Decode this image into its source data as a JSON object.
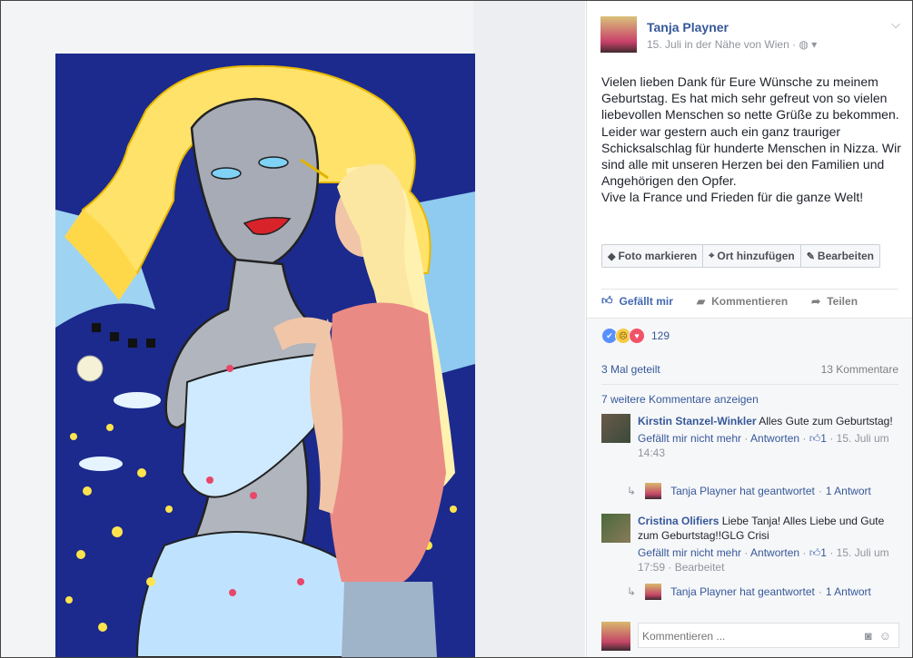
{
  "post": {
    "author": "Tanja Playner",
    "date": "15. Juli in der Nähe von Wien",
    "meta_sep": " · ",
    "privacy_icon": "globe-icon",
    "text": [
      "Vielen lieben Dank für Eure Wünsche zu meinem Geburtstag. Es hat mich sehr gefreut von so vielen liebevollen Menschen so nette Grüße zu bekommen.",
      "Leider war gestern auch ein ganz trauriger Schicksalschlag für hunderte Menschen in Nizza. Wir sind alle mit unseren Herzen bei den Familien und Angehörigen den Opfer.",
      "Vive la France und Frieden für die ganze Welt!"
    ]
  },
  "photo_actions": {
    "tag": "Foto markieren",
    "location": "Ort hinzufügen",
    "edit": "Bearbeiten"
  },
  "action_bar": {
    "like": "Gefällt mir",
    "comment": "Kommentieren",
    "share": "Teilen"
  },
  "reactions": {
    "count": "129",
    "types": [
      "like",
      "sad",
      "love"
    ]
  },
  "stats": {
    "shares": "3 Mal geteilt",
    "comments": "13 Kommentare"
  },
  "more_comments": "7 weitere Kommentare anzeigen",
  "comments": [
    {
      "author": "Kirstin Stanzel-Winkler",
      "text": "Alles Gute zum Geburtstag!",
      "unlike": "Gefällt mir nicht mehr",
      "reply": "Antworten",
      "likes": "1",
      "time": "15. Juli um 14:43",
      "edited": "",
      "reply_summary": {
        "text": "Tanja Playner hat geantwortet",
        "count": "1 Antwort"
      }
    },
    {
      "author": "Cristina Olifiers",
      "text": "Liebe Tanja! Alles Liebe und Gute zum Geburtstag!!GLG Crisi",
      "unlike": "Gefällt mir nicht mehr",
      "reply": "Antworten",
      "likes": "1",
      "time": "15. Juli um 17:59",
      "edited": "Bearbeitet",
      "reply_summary": {
        "text": "Tanja Playner hat geantwortet",
        "count": "1 Antwort"
      }
    }
  ],
  "composer": {
    "placeholder": "Kommentieren ..."
  },
  "colors": {
    "link": "#365899",
    "like_blue": "#4267b2",
    "meta_gray": "#90949c",
    "canvas_blue": "#1b2a8c",
    "hair_yellow": "#ffe26a"
  }
}
